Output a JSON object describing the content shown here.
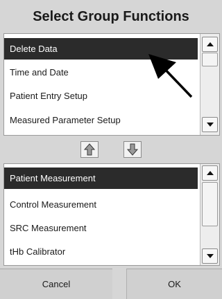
{
  "title": "Select Group Functions",
  "available_list": {
    "items": [
      "Delete Data",
      "Time and Date",
      "Patient Entry Setup",
      "Measured Parameter Setup"
    ],
    "selected_index": 0
  },
  "group_list": {
    "items": [
      "Patient Measurement",
      "Control Measurement",
      "SRC Measurement",
      "tHb Calibrator"
    ],
    "selected_index": 0
  },
  "buttons": {
    "cancel": "Cancel",
    "ok": "OK"
  },
  "icons": {
    "move_up": "arrow-up-icon",
    "move_down": "arrow-down-icon"
  },
  "colors": {
    "selected_bg": "#2b2b2b",
    "background": "#d6d6d6"
  }
}
